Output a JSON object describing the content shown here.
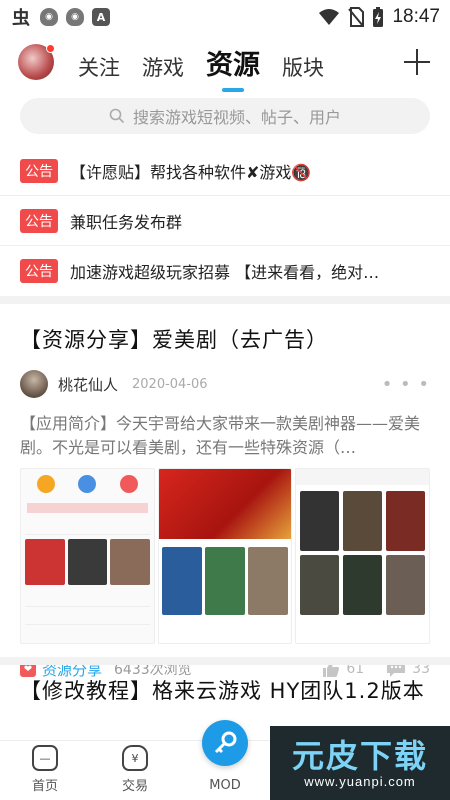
{
  "status_bar": {
    "time": "18:47",
    "left_icons": [
      "app-logo-icon",
      "shield-icon",
      "shield-icon",
      "a-icon"
    ],
    "right_icons": [
      "wifi-icon",
      "no-sim-icon",
      "battery-charging-icon"
    ]
  },
  "header": {
    "tabs": [
      {
        "label": "关注"
      },
      {
        "label": "游戏"
      },
      {
        "label": "资源"
      },
      {
        "label": "版块"
      }
    ],
    "active_tab": "资源",
    "accent_color": "#2aa7e8"
  },
  "search": {
    "placeholder": "搜索游戏短视频、帖子、用户"
  },
  "notices": [
    {
      "badge": "公告",
      "text": "【许愿贴】帮找各种软件✘游戏🔞"
    },
    {
      "badge": "公告",
      "text": "兼职任务发布群"
    },
    {
      "badge": "公告",
      "text": "加速游戏超级玩家招募 【进来看看，绝对…"
    }
  ],
  "post": {
    "title": "【资源分享】爱美剧（去广告）",
    "author": "桃花仙人",
    "date": "2020-04-06",
    "summary": "【应用简介】今天宇哥给大家带来一款美剧神器——爱美剧。不光是可以看美剧，还有一些特殊资源（…",
    "category": "资源分享",
    "views": "6433次浏览",
    "likes": "61",
    "comments": "33"
  },
  "post2": {
    "title": "【修改教程】格来云游戏 HY团队1.2版本"
  },
  "bottom_nav": {
    "items": [
      {
        "label": "首页"
      },
      {
        "label": "交易"
      },
      {
        "label": "MOD"
      }
    ]
  },
  "watermark": {
    "text": "元皮下载",
    "url": "www.yuanpi.com"
  }
}
